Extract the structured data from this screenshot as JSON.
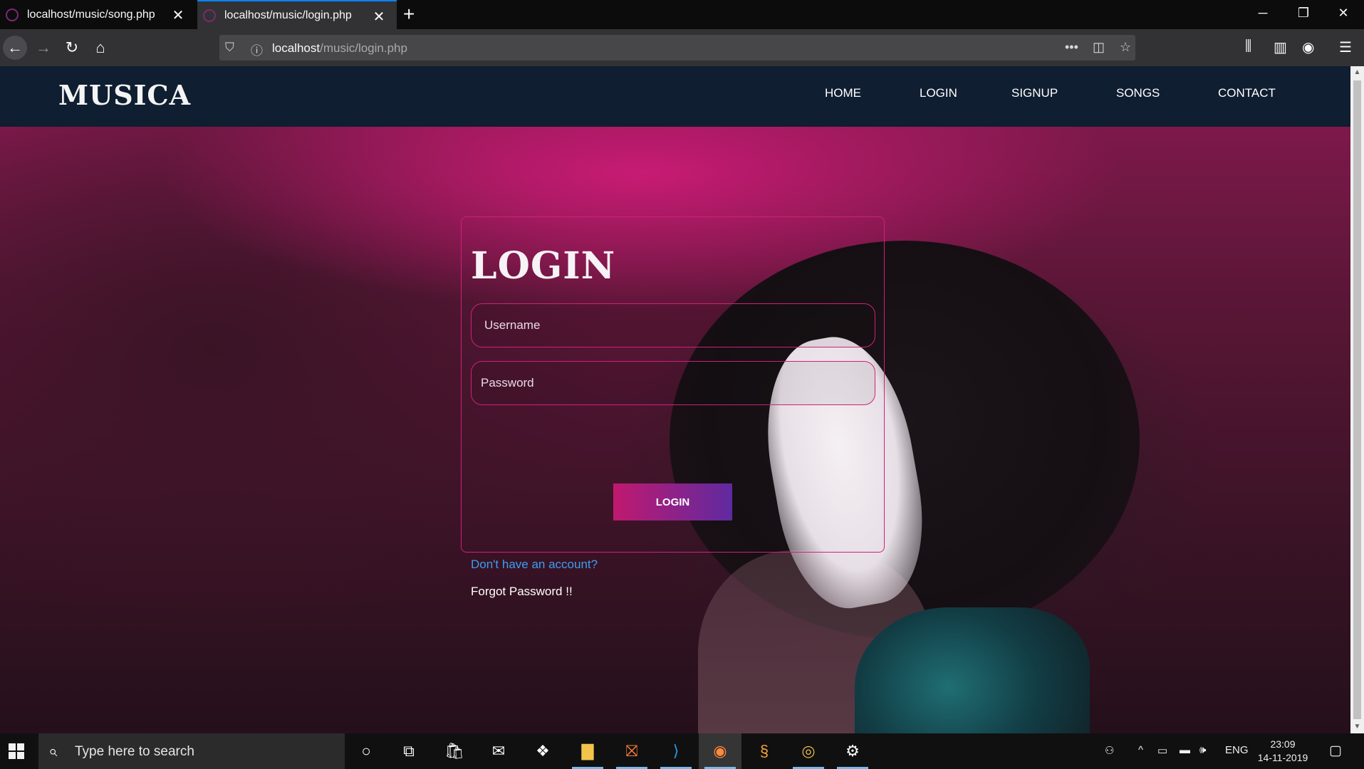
{
  "browser": {
    "tabs": [
      {
        "title": "localhost/music/song.php",
        "active": false
      },
      {
        "title": "localhost/music/login.php",
        "active": true
      }
    ],
    "url_host": "localhost",
    "url_path": "/music/login.php",
    "icons": {
      "back": "back-arrow-icon",
      "forward": "forward-arrow-icon",
      "reload": "reload-icon",
      "home": "home-icon",
      "shield": "tracking-shield-icon",
      "info": "site-info-icon",
      "more": "page-actions-icon",
      "pocket": "pocket-icon",
      "bookmark": "bookmark-star-icon",
      "library": "library-icon",
      "sidebar": "sidebar-icon",
      "account": "account-icon",
      "menu": "hamburger-menu-icon"
    }
  },
  "site": {
    "logo": "MUSICA",
    "nav": [
      "HOME",
      "LOGIN",
      "SIGNUP",
      "SONGS",
      "CONTACT"
    ],
    "header_color": "#0f1e31",
    "accent_color": "#d11f7b"
  },
  "login": {
    "title": "LOGIN",
    "username_placeholder": "Username",
    "password_placeholder": "Password",
    "button_label": "LOGIN",
    "signup_link": "Don't have an account?",
    "forgot_link": "Forgot Password !!",
    "link_color": "#3c9ef0"
  },
  "taskbar": {
    "search_placeholder": "Type here to search",
    "language": "ENG",
    "time": "23:09",
    "date": "14-11-2019"
  }
}
